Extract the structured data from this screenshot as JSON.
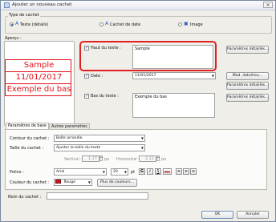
{
  "window": {
    "title": "Ajouter un nouveau cachet",
    "close_glyph": "×"
  },
  "stamp_type": {
    "legend": "Type de cachet",
    "options": [
      {
        "label": "Texte (détails)",
        "selected": true
      },
      {
        "label": "Cachet de date",
        "selected": false
      },
      {
        "label": "Image",
        "selected": false
      }
    ]
  },
  "preview": {
    "label": "Aperçu :",
    "lines": [
      "Sample",
      "11/01/2017",
      "Exemple du bas"
    ],
    "color": "#e0101a"
  },
  "top_text": {
    "label": "Haut du texte :",
    "checked": true,
    "value": "Sample",
    "details_button": "Paramètres détaillés..."
  },
  "date": {
    "label": "Date :",
    "checked": true,
    "value": "11/01/2017",
    "format_button": "Mod. date/heu...",
    "details_button": "Paramètres détaillés..."
  },
  "bottom_text": {
    "label": "Bas du texte :",
    "checked": true,
    "value": "Exemple du bas",
    "details_button": "Paramètres détaillés..."
  },
  "tabs": [
    {
      "label": "Paramètres de base",
      "active": true
    },
    {
      "label": "Autres paramètres",
      "active": false
    }
  ],
  "basic": {
    "outline_label": "Contour du cachet :",
    "outline_value": "Boîte arrondie",
    "size_label": "Taille du cachet :",
    "size_value": "Ajuster la taille du texte",
    "vertical_label": "Vertical :",
    "vertical_value": "1,17",
    "vertical_unit": "po",
    "horizontal_label": "Horizontal :",
    "horizontal_value": "2,11",
    "horizontal_unit": "po",
    "font_label": "Police :",
    "font_value": "Arial",
    "font_size": "20",
    "font_size_unit": "pt",
    "style_buttons": [
      "G",
      "I",
      "S",
      "abc"
    ],
    "color_label": "Couleur du cachet :",
    "color_value": "Rouge",
    "color_swatch": "#d4161c",
    "more_colors_button": "Plus de couleurs..."
  },
  "name": {
    "label": "Nom du cachet :",
    "value": ""
  },
  "footer": {
    "ok": "OK",
    "cancel": "Annuler"
  },
  "highlight_color": "#e02020"
}
